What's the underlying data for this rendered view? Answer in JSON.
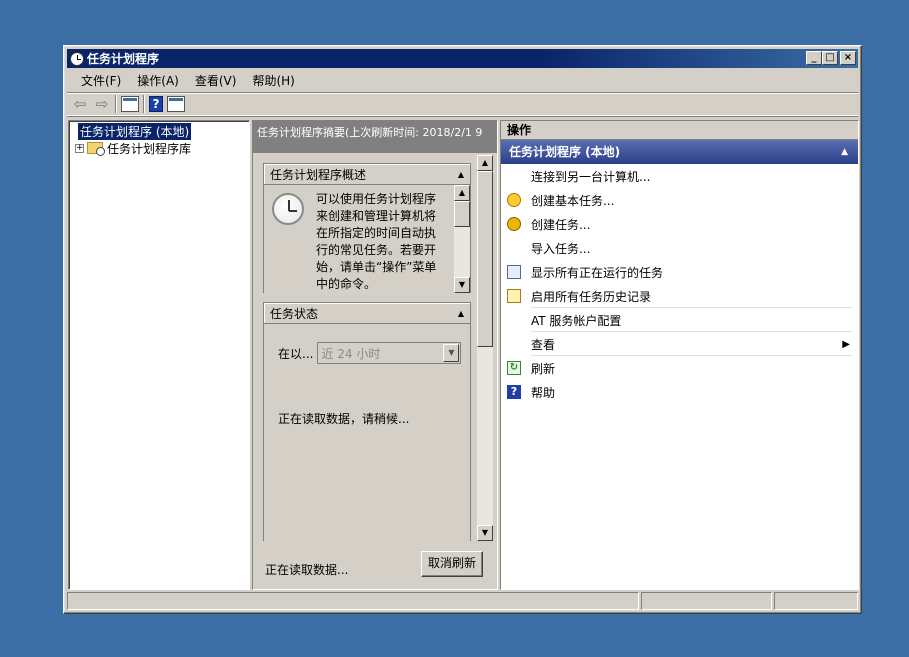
{
  "window": {
    "title": "任务计划程序",
    "min_label": "_",
    "max_label": "□",
    "close_label": "×"
  },
  "menu": {
    "file": "文件(F)",
    "action": "操作(A)",
    "view": "查看(V)",
    "help": "帮助(H)"
  },
  "toolbar": {
    "back": "⇦",
    "forward": "⇨",
    "help": "?"
  },
  "tree": {
    "root": "任务计划程序 (本地)",
    "library": "任务计划程序库",
    "expander": "+"
  },
  "middle": {
    "header": "任务计划程序摘要(上次刷新时间: 2018/2/1 9",
    "overview": {
      "title": "任务计划程序概述",
      "text": "可以使用任务计划程序来创建和管理计算机将在所指定的时间自动执行的常见任务。若要开始，请单击“操作”菜单中的命令。"
    },
    "status": {
      "title": "任务状态",
      "filter_label": "在以...",
      "filter_value": "近 24 小时",
      "loading": "正在读取数据，请稍候..."
    },
    "footer_status": "正在读取数据...",
    "cancel_refresh": "取消刷新"
  },
  "actions": {
    "title": "操作",
    "group": "任务计划程序 (本地)",
    "items": [
      {
        "label": "连接到另一台计算机...",
        "icon": "none"
      },
      {
        "label": "创建基本任务...",
        "icon": "create-basic-task-icon"
      },
      {
        "label": "创建任务...",
        "icon": "create-task-icon"
      },
      {
        "label": "导入任务...",
        "icon": "none"
      },
      {
        "label": "显示所有正在运行的任务",
        "icon": "running-tasks-icon"
      },
      {
        "label": "启用所有任务历史记录",
        "icon": "task-history-icon"
      },
      {
        "label": "AT 服务帐户配置",
        "icon": "none"
      },
      {
        "label": "查看",
        "icon": "none"
      },
      {
        "label": "刷新",
        "icon": "refresh-icon"
      },
      {
        "label": "帮助",
        "icon": "help-icon"
      }
    ]
  }
}
